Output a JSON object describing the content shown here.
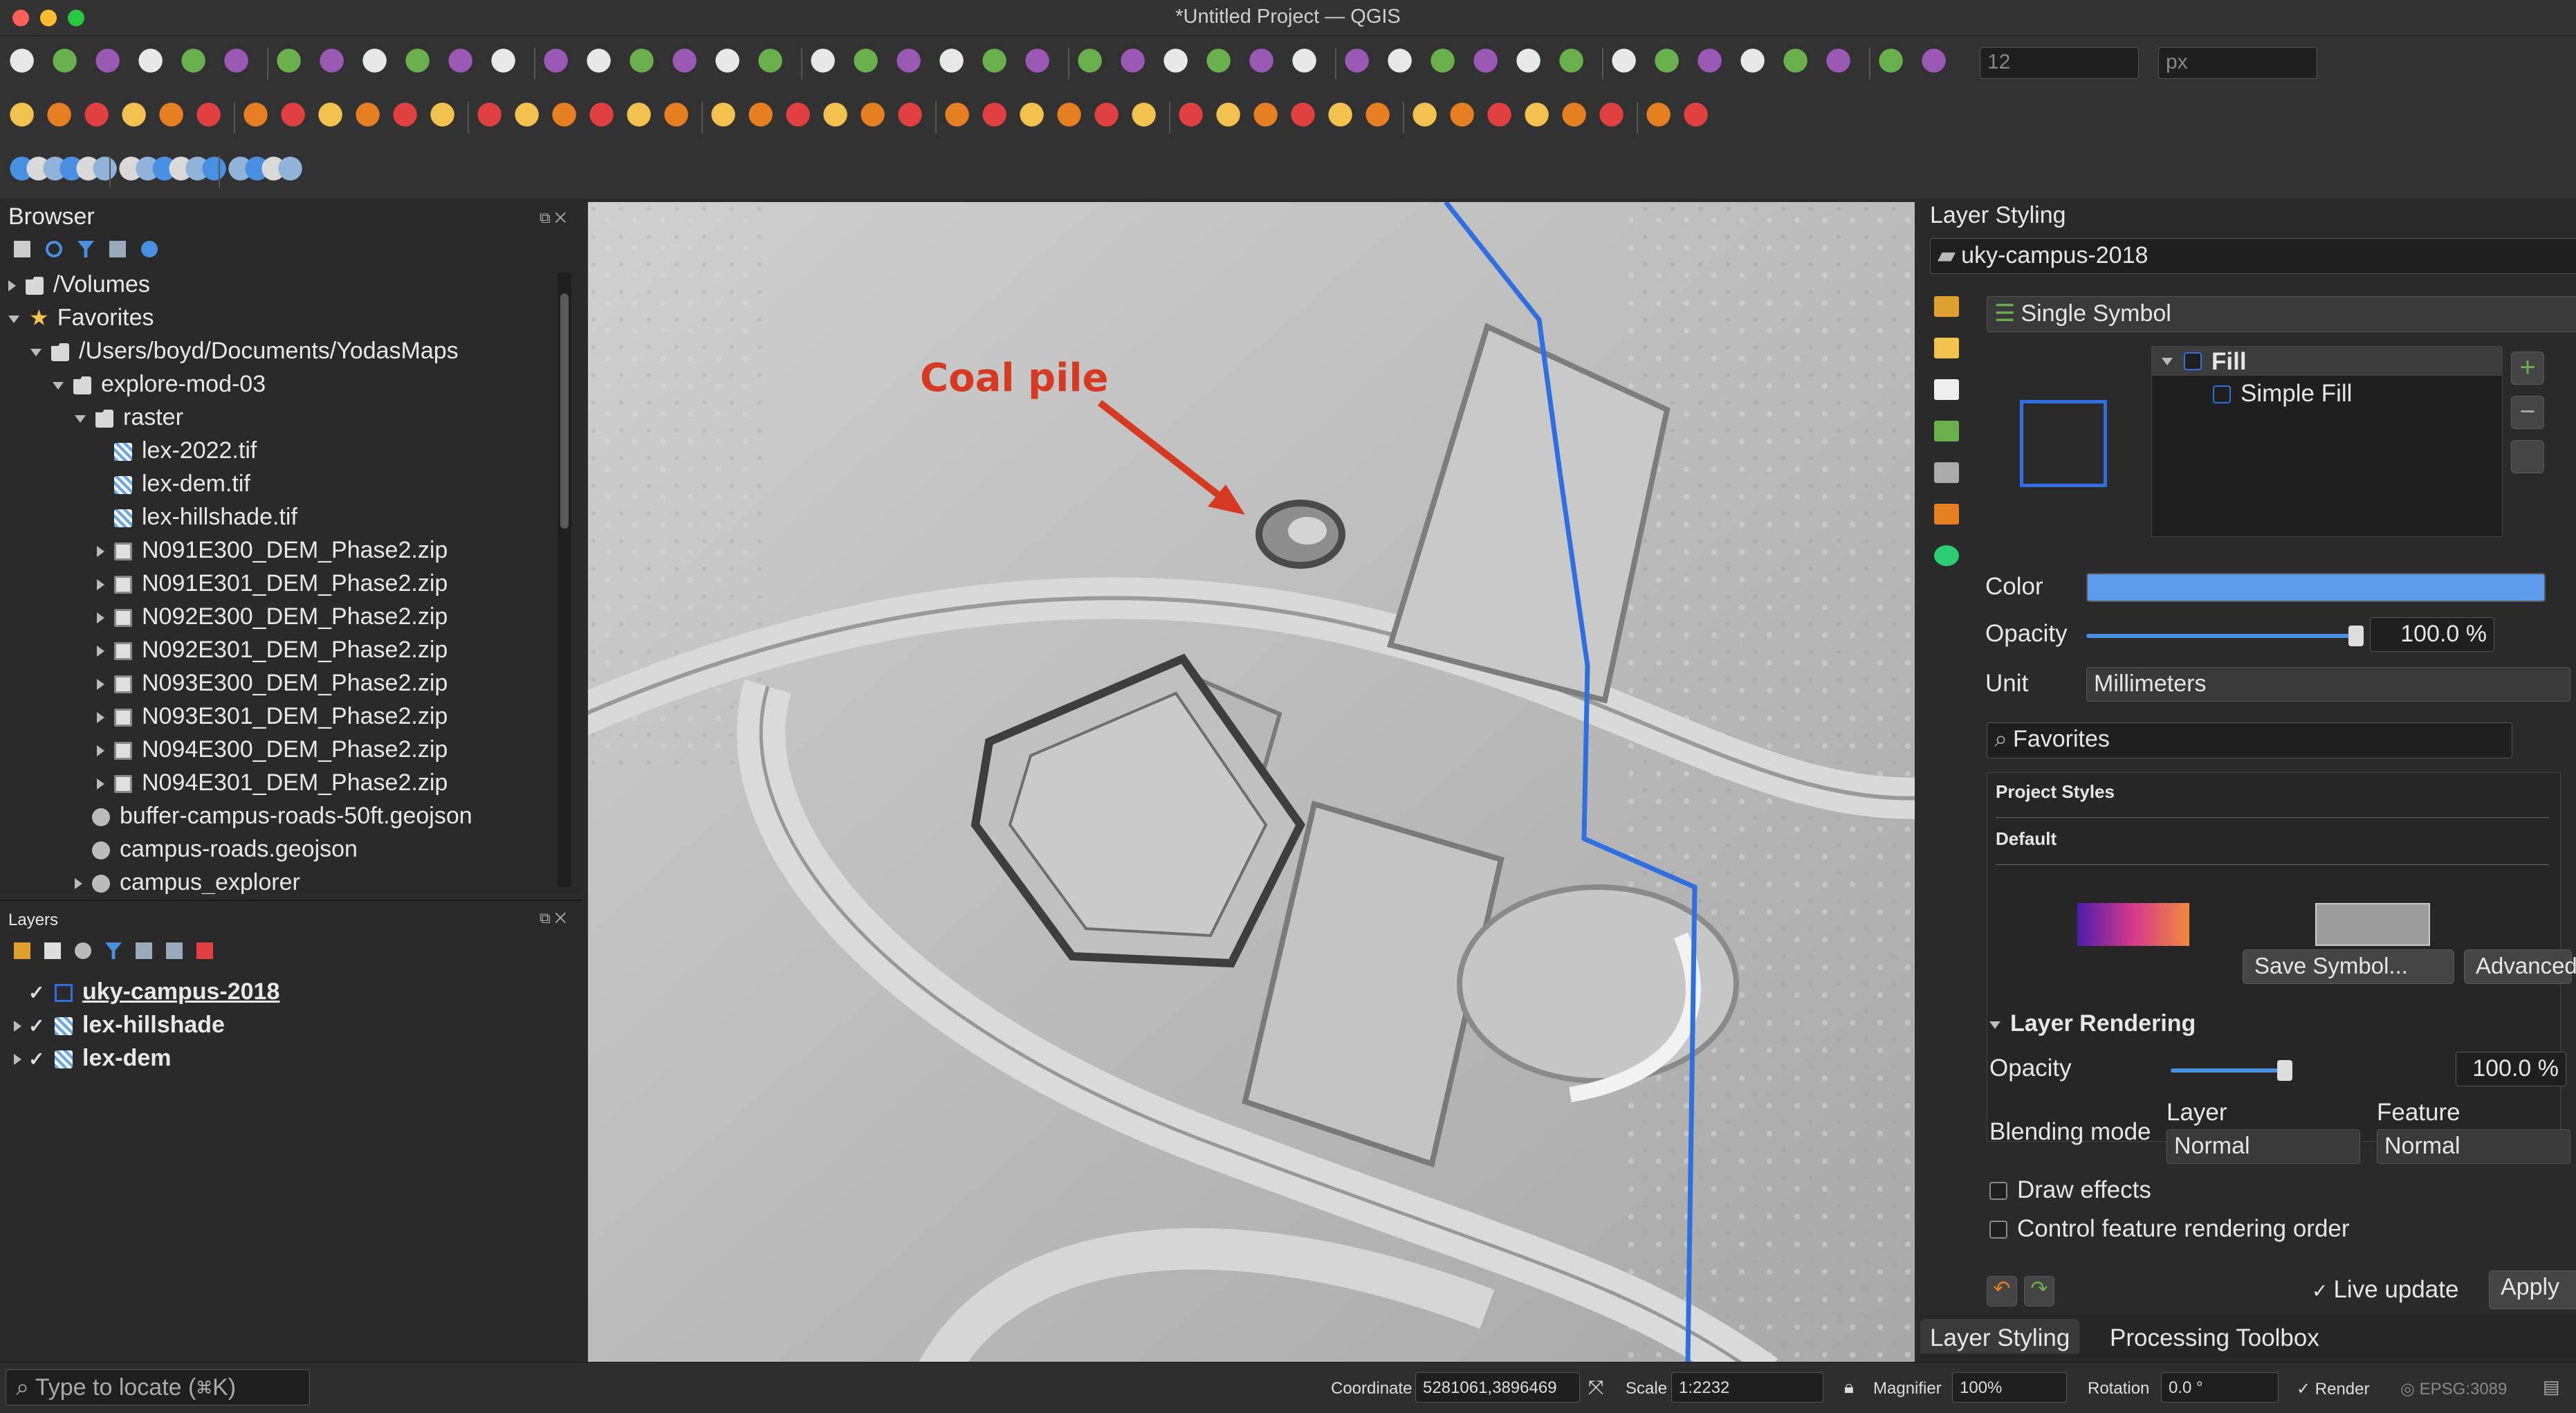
{
  "window": {
    "title": "*Untitled Project — QGIS"
  },
  "browser": {
    "title": "Browser",
    "items": [
      {
        "label": "/Volumes",
        "depth": 0,
        "icon": "folder-icon",
        "expander": "collapsed"
      },
      {
        "label": "Favorites",
        "depth": 0,
        "icon": "star-icon",
        "expander": "expanded"
      },
      {
        "label": "/Users/boyd/Documents/YodasMaps",
        "depth": 1,
        "icon": "folder-icon",
        "expander": "expanded"
      },
      {
        "label": "explore-mod-03",
        "depth": 2,
        "icon": "folder-icon",
        "expander": "expanded"
      },
      {
        "label": "raster",
        "depth": 3,
        "icon": "folder-icon",
        "expander": "expanded"
      },
      {
        "label": "lex-2022.tif",
        "depth": 4,
        "icon": "raster-icon",
        "expander": "none"
      },
      {
        "label": "lex-dem.tif",
        "depth": 4,
        "icon": "raster-icon",
        "expander": "none"
      },
      {
        "label": "lex-hillshade.tif",
        "depth": 4,
        "icon": "raster-icon",
        "expander": "none"
      },
      {
        "label": "N091E300_DEM_Phase2.zip",
        "depth": 4,
        "icon": "zip-icon",
        "expander": "collapsed"
      },
      {
        "label": "N091E301_DEM_Phase2.zip",
        "depth": 4,
        "icon": "zip-icon",
        "expander": "collapsed"
      },
      {
        "label": "N092E300_DEM_Phase2.zip",
        "depth": 4,
        "icon": "zip-icon",
        "expander": "collapsed"
      },
      {
        "label": "N092E301_DEM_Phase2.zip",
        "depth": 4,
        "icon": "zip-icon",
        "expander": "collapsed"
      },
      {
        "label": "N093E300_DEM_Phase2.zip",
        "depth": 4,
        "icon": "zip-icon",
        "expander": "collapsed"
      },
      {
        "label": "N093E301_DEM_Phase2.zip",
        "depth": 4,
        "icon": "zip-icon",
        "expander": "collapsed"
      },
      {
        "label": "N094E300_DEM_Phase2.zip",
        "depth": 4,
        "icon": "zip-icon",
        "expander": "collapsed"
      },
      {
        "label": "N094E301_DEM_Phase2.zip",
        "depth": 4,
        "icon": "zip-icon",
        "expander": "collapsed"
      },
      {
        "label": "buffer-campus-roads-50ft.geojson",
        "depth": 3,
        "icon": "vector-icon",
        "expander": "none"
      },
      {
        "label": "campus-roads.geojson",
        "depth": 3,
        "icon": "vector-icon",
        "expander": "none"
      },
      {
        "label": "campus_explorer",
        "depth": 3,
        "icon": "vector-icon",
        "expander": "collapsed"
      }
    ]
  },
  "layers": {
    "title": "Layers",
    "items": [
      {
        "label": "uky-campus-2018",
        "checked": true,
        "icon": "polygon-icon",
        "active": true
      },
      {
        "label": "lex-hillshade",
        "checked": true,
        "icon": "raster-icon",
        "active": false
      },
      {
        "label": "lex-dem",
        "checked": true,
        "icon": "raster-icon",
        "active": false
      }
    ]
  },
  "map": {
    "annotation": "Coal pile",
    "boundary_color": "#2f6fe0",
    "annotation_color": "#d63a22"
  },
  "styling": {
    "title": "Layer Styling",
    "layer_select": "uky-campus-2018",
    "renderer": "Single Symbol",
    "symbol_tree": {
      "fill": "Fill",
      "simple_fill": "Simple Fill"
    },
    "color_label": "Color",
    "color_value": "#5b9bea",
    "opacity_label": "Opacity",
    "opacity_value": "100.0 %",
    "opacity_fraction": 1.0,
    "unit_label": "Unit",
    "unit_value": "Millimeters",
    "search_value": "Favorites",
    "project_styles": "Project Styles",
    "default": "Default",
    "save_symbol": "Save Symbol...",
    "advanced": "Advanced",
    "rendering_title": "Layer Rendering",
    "rendering_opacity_label": "Opacity",
    "rendering_opacity_value": "100.0 %",
    "blending_label": "Blending mode",
    "blend_layer_label": "Layer",
    "blend_feature_label": "Feature",
    "blend_layer_value": "Normal",
    "blend_feature_value": "Normal",
    "draw_effects": "Draw effects",
    "control_order": "Control feature rendering order",
    "live_update": "Live update",
    "apply": "Apply",
    "tabs": [
      "Layer Styling",
      "Processing Toolbox"
    ]
  },
  "toolbar": {
    "font_size": "12",
    "font_unit": "px"
  },
  "status": {
    "locator_placeholder": "Type to locate (⌘K)",
    "coordinate_label": "Coordinate",
    "coordinate_value": "5281061,3896469",
    "scale_label": "Scale",
    "scale_value": "1:2232",
    "magnifier_label": "Magnifier",
    "magnifier_value": "100%",
    "rotation_label": "Rotation",
    "rotation_value": "0.0 °",
    "render_label": "Render",
    "crs": "EPSG:3089"
  }
}
